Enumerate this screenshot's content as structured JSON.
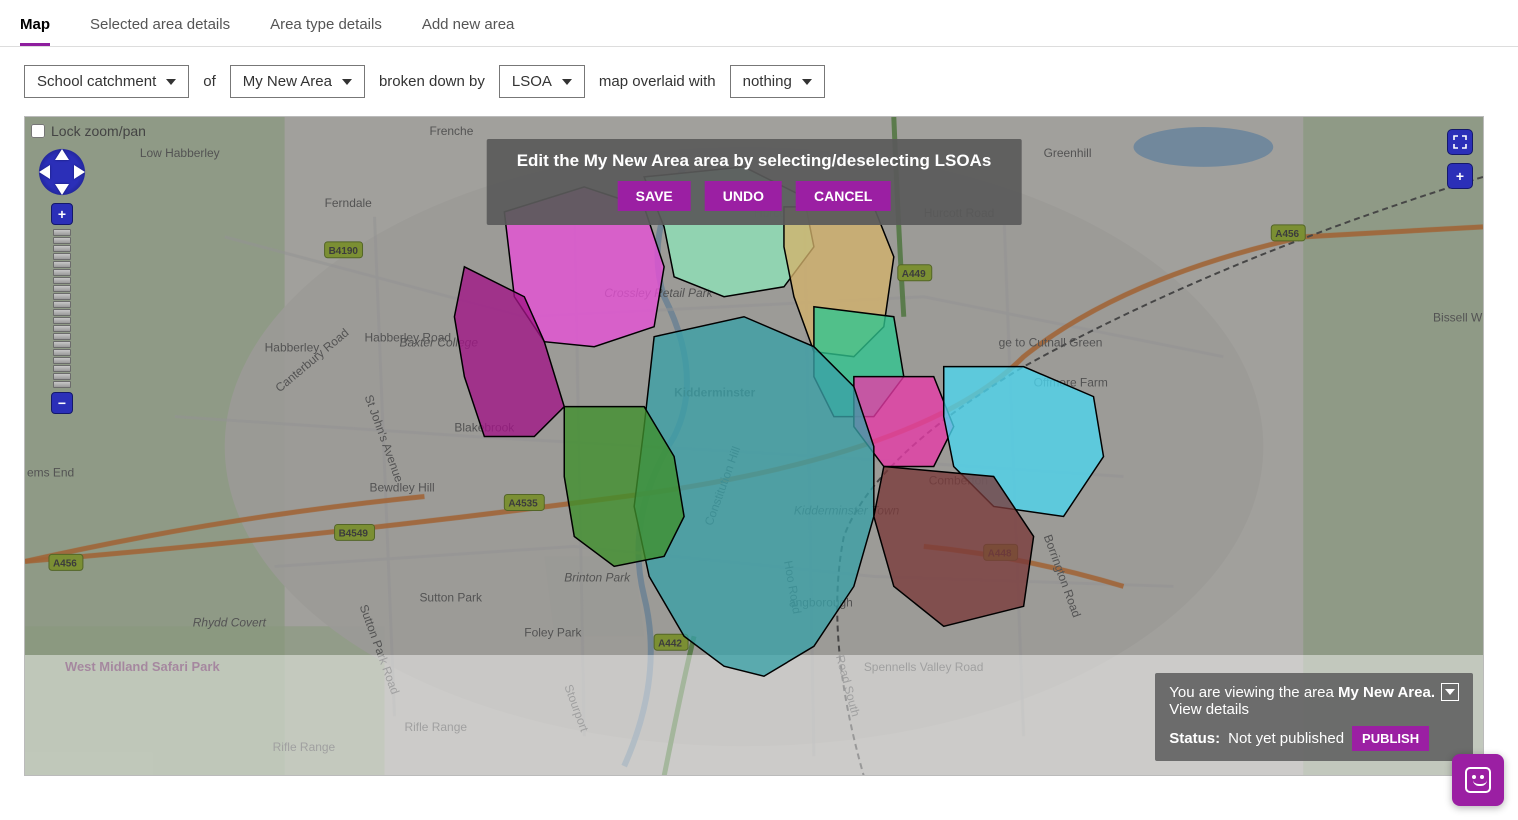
{
  "tabs": [
    {
      "label": "Map",
      "active": true
    },
    {
      "label": "Selected area details",
      "active": false
    },
    {
      "label": "Area type details",
      "active": false
    },
    {
      "label": "Add new area",
      "active": false
    }
  ],
  "filters": {
    "dropdown1": "School catchment",
    "text_of": "of",
    "dropdown2": "My New Area",
    "text_broken": "broken down by",
    "dropdown3": "LSOA",
    "text_overlaid": "map overlaid with",
    "dropdown4": "nothing"
  },
  "lock_label": "Lock zoom/pan",
  "edit_panel": {
    "title": "Edit the My New Area area by selecting/deselecting LSOAs",
    "save": "SAVE",
    "undo": "UNDO",
    "cancel": "CANCEL"
  },
  "info_panel": {
    "line1_prefix": "You are viewing the area ",
    "line1_area": "My New Area.",
    "view_details": "View details",
    "status_label": "Status:",
    "status_value": "Not yet published",
    "publish": "PUBLISH"
  },
  "map_places": {
    "frenche": "Frenche",
    "ferndale": "Ferndale",
    "low_habberley": "Low Habberley",
    "habberley": "Habberley",
    "baxter": "Baxter College",
    "crossley": "Crossley Retail Park",
    "kidderminster": "Kidderminster",
    "kidderminster_town": "Kidderminster Town",
    "blakebrook": "Blakebrook",
    "sutton_park": "Sutton Park",
    "brinton_park": "Brinton Park",
    "foley_park": "Foley Park",
    "rifle_range": "Rifle Range",
    "rhydd_covert": "Rhydd Covert",
    "west_midland": "West Midland Safari Park",
    "ems_end": "ems End",
    "comberton": "Comberton",
    "offmore": "Offmore Farm",
    "hurcott": "Hurcott",
    "greenhill": "Greenhill",
    "bissell": "Bissell W",
    "spennells": "Spennells Valley Road",
    "angborough": "angborough",
    "to_cutnall": "ge to Cutnall Green",
    "habberley_rd": "Habberley Road",
    "canterbury": "Canterbury Road",
    "stjohns": "St John's Avenue",
    "bewdley_hill": "Bewdley Hill",
    "sutton_rd": "Sutton Park Road",
    "hoo_rd": "Hoo Road",
    "hurcott_rd": "Hurcott Road",
    "road_south": "Road South",
    "stourport": "Stourport",
    "borrington": "Borrington Road",
    "constitution": "Constitution Hill",
    "b4190": "B4190",
    "a456_left": "A456",
    "a456_right": "A456",
    "a449": "A449",
    "a442": "A442",
    "a448": "A448",
    "a4535": "A4535",
    "b4549": "B4549"
  },
  "regions": [
    {
      "name": "pink-north",
      "fill": "#e84fd7"
    },
    {
      "name": "darkmagenta-west",
      "fill": "#a11587"
    },
    {
      "name": "mint-north",
      "fill": "#8ee3b8"
    },
    {
      "name": "tan-northeast",
      "fill": "#d4b26b"
    },
    {
      "name": "teal-center",
      "fill": "#3aa0a6"
    },
    {
      "name": "green-southwest",
      "fill": "#3f8f2b"
    },
    {
      "name": "seagreen-east",
      "fill": "#2fc58f"
    },
    {
      "name": "hotpink-east",
      "fill": "#e83aa8"
    },
    {
      "name": "cyan-fareast",
      "fill": "#4bd6ef"
    },
    {
      "name": "maroon-southeast",
      "fill": "#7a3a3a"
    }
  ]
}
